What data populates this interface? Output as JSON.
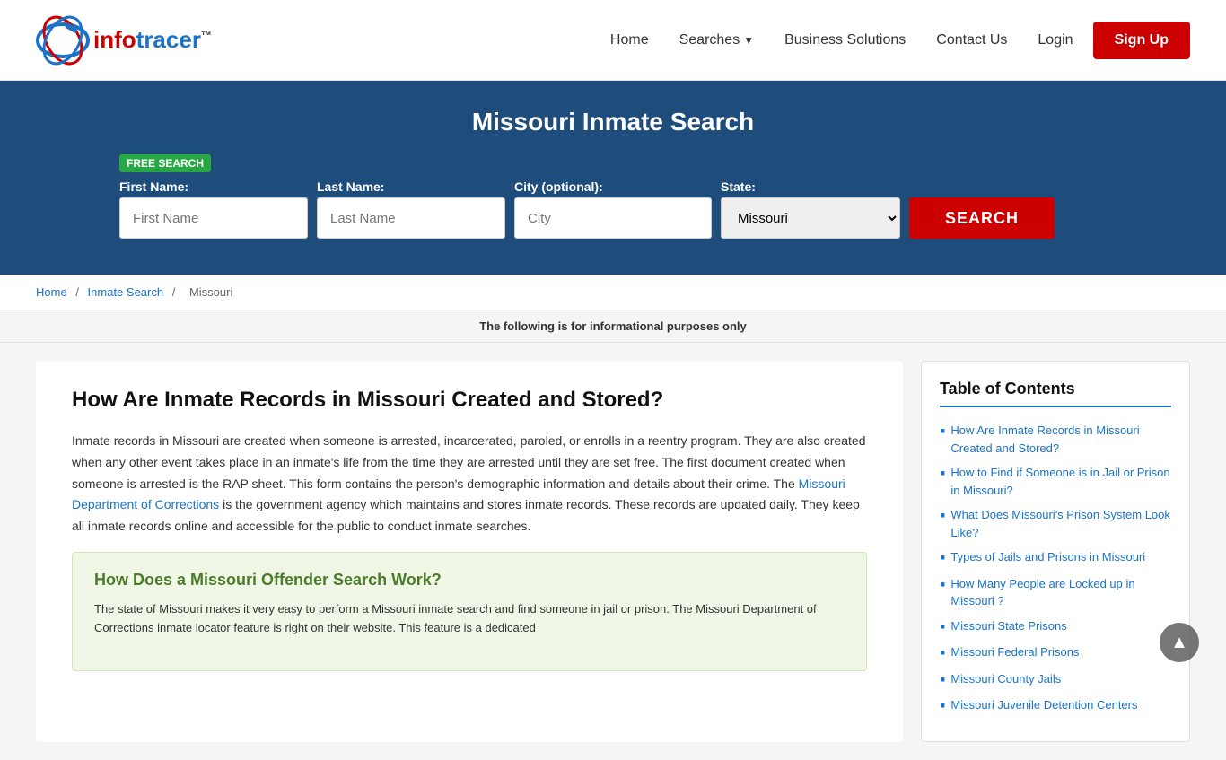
{
  "header": {
    "logo_text_red": "info",
    "logo_text_blue": "tracer",
    "logo_tm": "™",
    "nav": {
      "home": "Home",
      "searches": "Searches",
      "searches_chevron": "▼",
      "business_solutions": "Business Solutions",
      "contact_us": "Contact Us",
      "login": "Login",
      "sign_up": "Sign Up"
    }
  },
  "hero": {
    "title": "Missouri Inmate Search",
    "free_badge": "FREE SEARCH",
    "form": {
      "first_name_label": "First Name:",
      "first_name_placeholder": "First Name",
      "last_name_label": "Last Name:",
      "last_name_placeholder": "Last Name",
      "city_label": "City (optional):",
      "city_placeholder": "City",
      "state_label": "State:",
      "state_value": "Missouri",
      "search_button": "SEARCH"
    }
  },
  "breadcrumb": {
    "home": "Home",
    "inmate_search": "Inmate Search",
    "missouri": "Missouri"
  },
  "info_bar": {
    "text": "The following is for informational purposes only"
  },
  "article": {
    "heading": "How Are Inmate Records in Missouri Created and Stored?",
    "paragraph1": "Inmate records in Missouri are created when someone is arrested, incarcerated, paroled, or enrolls in a reentry program. They are also created when any other event takes place in an inmate's life from the time they are arrested until they are set free. The first document created when someone is arrested is the RAP sheet. This form contains the person's demographic information and details about their crime. The",
    "dept_link_text": "Missouri Department of Corrections",
    "paragraph1_cont": "is the government agency which maintains and stores inmate records. These records are updated daily. They keep all inmate records online and accessible for the public to conduct inmate searches.",
    "info_box": {
      "heading": "How Does a Missouri Offender Search Work?",
      "text": "The state of Missouri makes it very easy to perform a Missouri inmate search and find someone in jail or prison. The Missouri Department of Corrections inmate locator feature is right on their website. This feature is a dedicated"
    }
  },
  "toc": {
    "title": "Table of Contents",
    "items": [
      {
        "text": "How Are Inmate Records in Missouri Created and Stored?"
      },
      {
        "text": "How to Find if Someone is in Jail or Prison in Missouri?"
      },
      {
        "text": "What Does Missouri's Prison System Look Like?"
      },
      {
        "text": "Types of Jails and Prisons in Missouri"
      },
      {
        "text": "How Many People are Locked up in Missouri ?"
      },
      {
        "text": "Missouri State Prisons"
      },
      {
        "text": "Missouri Federal Prisons"
      },
      {
        "text": "Missouri County Jails"
      },
      {
        "text": "Missouri Juvenile Detention Centers"
      }
    ]
  },
  "back_to_top": "▲",
  "colors": {
    "accent_blue": "#1a73c8",
    "accent_red": "#cc0000",
    "hero_bg": "#1e4d7b",
    "green_badge": "#28a745",
    "info_box_heading": "#4a7c2a"
  }
}
